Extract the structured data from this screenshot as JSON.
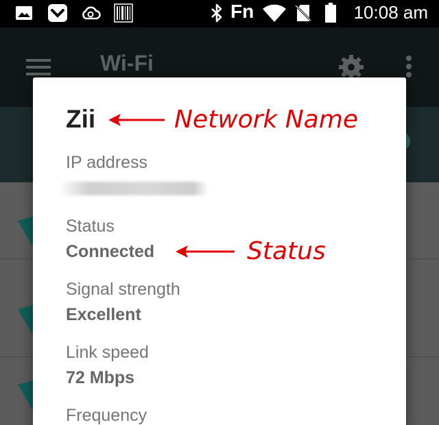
{
  "status_bar": {
    "fn_label": "Fn",
    "time": "10:08 am",
    "icons": [
      "image-icon",
      "pocket-icon",
      "cloud-sync-icon",
      "barcode-icon",
      "bluetooth-icon",
      "wifi-icon",
      "no-sim-icon",
      "battery-icon"
    ]
  },
  "app_bar": {
    "title": "Wi-Fi",
    "icons": [
      "menu-icon",
      "gear-icon",
      "more-vert-icon"
    ]
  },
  "dialog": {
    "network_name": "Zii",
    "fields": [
      {
        "label": "IP address",
        "value": ""
      },
      {
        "label": "Status",
        "value": "Connected"
      },
      {
        "label": "Signal strength",
        "value": "Excellent"
      },
      {
        "label": "Link speed",
        "value": "72 Mbps"
      },
      {
        "label": "Frequency",
        "value": ""
      }
    ]
  },
  "annotations": {
    "network_name": "Network Name",
    "status": "Status"
  },
  "colors": {
    "annotation": "#e30000",
    "accent": "#2d6a64"
  }
}
